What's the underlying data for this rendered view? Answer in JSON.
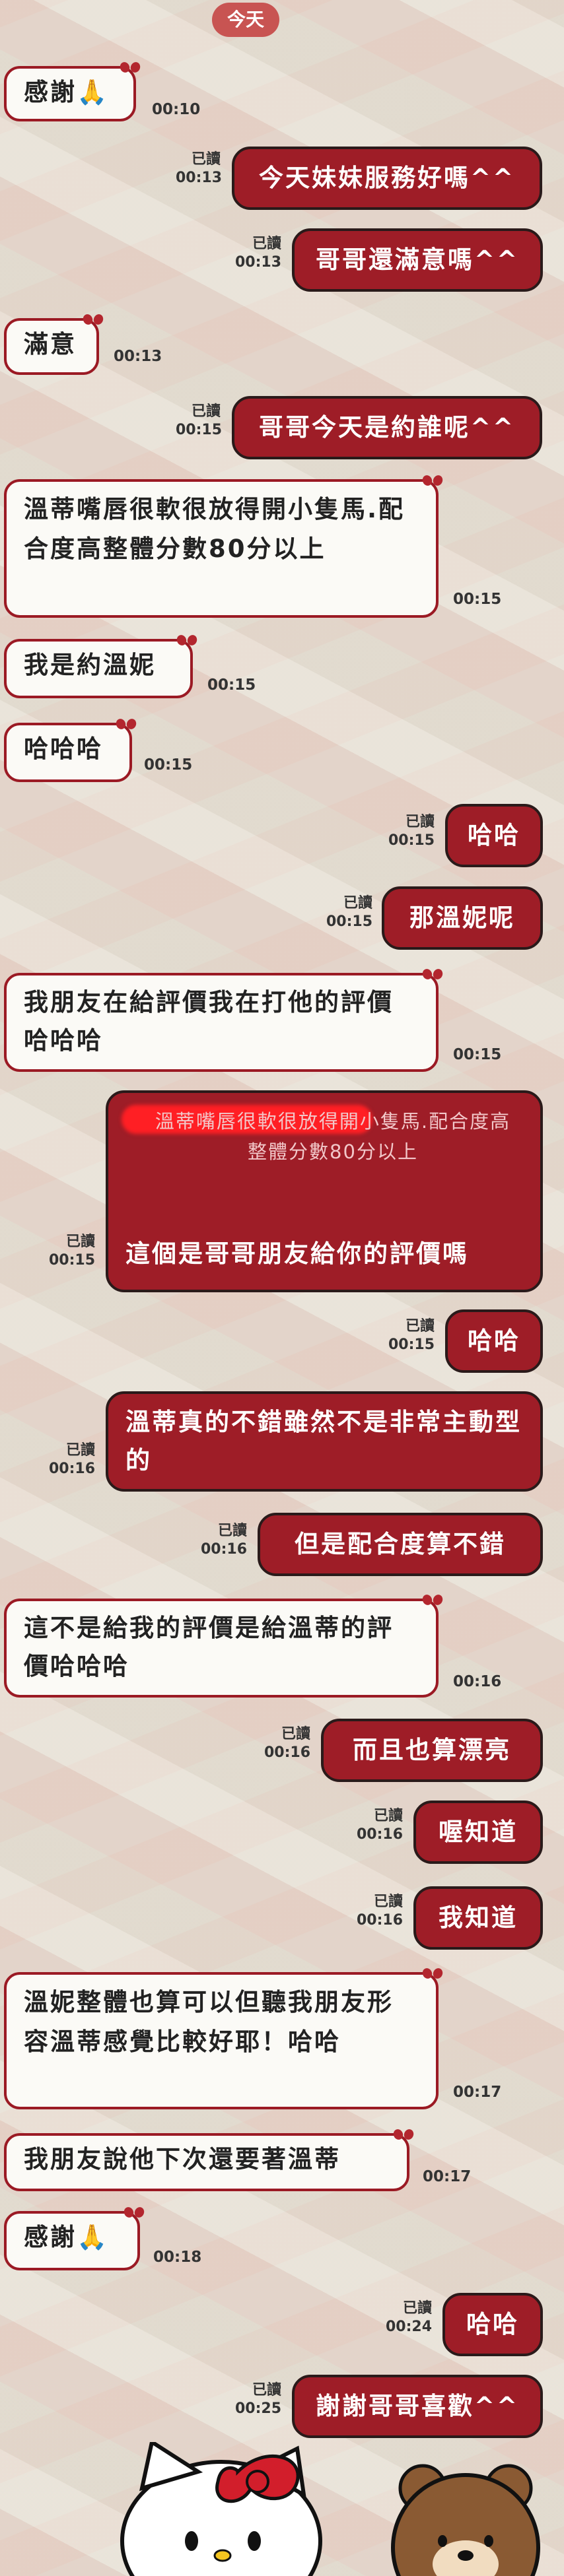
{
  "chat": {
    "date_label": "今天",
    "messages": [
      {
        "text": "感謝🙏",
        "time": "00:10"
      },
      {
        "text": "今天妹妹服務好嗎^^",
        "read": "已讀",
        "time": "00:13"
      },
      {
        "text": "哥哥還滿意嗎^^",
        "read": "已讀",
        "time": "00:13"
      },
      {
        "text": "滿意",
        "time": "00:13"
      },
      {
        "text": "哥哥今天是約誰呢^^",
        "read": "已讀",
        "time": "00:15"
      },
      {
        "text": "溫蒂嘴唇很軟很放得開小隻馬.配合度高整體分數80分以上",
        "time": "00:15"
      },
      {
        "text": "我是約溫妮",
        "time": "00:15"
      },
      {
        "text": "哈哈哈",
        "time": "00:15"
      },
      {
        "text": "哈哈",
        "read": "已讀",
        "time": "00:15"
      },
      {
        "text": "那溫妮呢",
        "read": "已讀",
        "time": "00:15"
      },
      {
        "text": "我朋友在給評價我在打他的評價哈哈哈",
        "time": "00:15"
      },
      {
        "quote": "溫蒂嘴唇很軟很放得開小隻馬.配合度高整體分數80分以上",
        "text": "這個是哥哥朋友給你的評價嗎",
        "read": "已讀",
        "time": "00:15"
      },
      {
        "text": "哈哈",
        "read": "已讀",
        "time": "00:15"
      },
      {
        "text": "溫蒂真的不錯雖然不是非常主動型的",
        "read": "已讀",
        "time": "00:16"
      },
      {
        "text": "但是配合度算不錯",
        "read": "已讀",
        "time": "00:16"
      },
      {
        "text": "這不是給我的評價是給溫蒂的評價哈哈哈",
        "time": "00:16"
      },
      {
        "text": "而且也算漂亮",
        "read": "已讀",
        "time": "00:16"
      },
      {
        "text": "喔知道",
        "read": "已讀",
        "time": "00:16"
      },
      {
        "text": "我知道",
        "read": "已讀",
        "time": "00:16"
      },
      {
        "text": "溫妮整體也算可以但聽我朋友形容溫蒂感覺比較好耶！哈哈",
        "time": "00:17"
      },
      {
        "text": "我朋友說他下次還要著溫蒂",
        "time": "00:17"
      },
      {
        "text": "感謝🙏",
        "time": "00:18"
      },
      {
        "text": "哈哈",
        "read": "已讀",
        "time": "00:24"
      },
      {
        "text": "謝謝哥哥喜歡^^",
        "read": "已讀",
        "time": "00:25"
      }
    ]
  },
  "colors": {
    "sent_bubble": "#9e1d27",
    "received_bubble": "#fbfaf6",
    "accent": "#c85452"
  }
}
